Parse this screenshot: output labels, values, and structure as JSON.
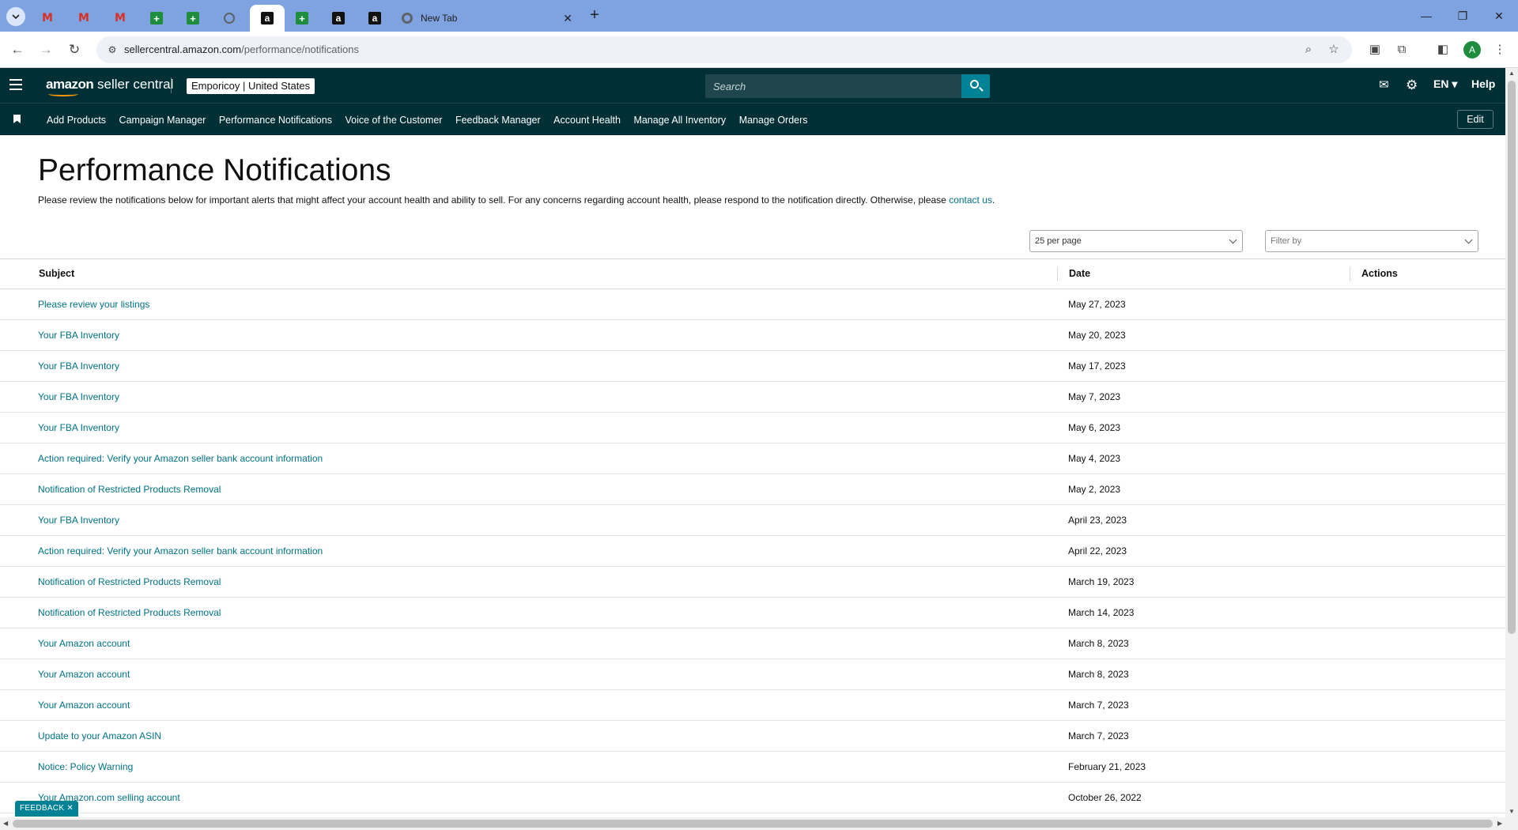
{
  "browser": {
    "tabs": [
      {
        "type": "gmail",
        "glyph": "M"
      },
      {
        "type": "gmail",
        "glyph": "M"
      },
      {
        "type": "gmail",
        "glyph": "M"
      },
      {
        "type": "sheets",
        "glyph": "+"
      },
      {
        "type": "sheets",
        "glyph": "+"
      },
      {
        "type": "globe",
        "glyph": ""
      },
      {
        "type": "amazon",
        "glyph": "a",
        "active": true
      },
      {
        "type": "sheets",
        "glyph": "+"
      },
      {
        "type": "amazon",
        "glyph": "a"
      },
      {
        "type": "amazon",
        "glyph": "a"
      }
    ],
    "new_tab_title": "New Tab",
    "url_domain": "sellercentral.amazon.com",
    "url_path": "/performance/notifications",
    "profile_initial": "A"
  },
  "header": {
    "logo_bold": "amazon",
    "logo_rest": " seller central",
    "store_name": "Emporicoy",
    "store_region": "United States",
    "search_placeholder": "Search",
    "lang": "EN",
    "help": "Help"
  },
  "nav": {
    "links": [
      "Add Products",
      "Campaign Manager",
      "Performance Notifications",
      "Voice of the Customer",
      "Feedback Manager",
      "Account Health",
      "Manage All Inventory",
      "Manage Orders"
    ],
    "edit": "Edit"
  },
  "page": {
    "title": "Performance Notifications",
    "intro": "Please review the notifications below for important alerts that might affect your account health and ability to sell. For any concerns regarding account health, please respond to the notification directly. Otherwise, please ",
    "intro_link": "contact us",
    "intro_end": ".",
    "per_page": "25 per page",
    "filter_placeholder": "Filter by"
  },
  "table": {
    "headers": {
      "subject": "Subject",
      "date": "Date",
      "actions": "Actions"
    },
    "rows": [
      {
        "subject": "Please review your listings",
        "date": "May 27, 2023"
      },
      {
        "subject": "Your FBA Inventory",
        "date": "May 20, 2023"
      },
      {
        "subject": "Your FBA Inventory",
        "date": "May 17, 2023"
      },
      {
        "subject": "Your FBA Inventory",
        "date": "May 7, 2023"
      },
      {
        "subject": "Your FBA Inventory",
        "date": "May 6, 2023"
      },
      {
        "subject": "Action required: Verify your Amazon seller bank account information",
        "date": "May 4, 2023"
      },
      {
        "subject": "Notification of Restricted Products Removal",
        "date": "May 2, 2023"
      },
      {
        "subject": "Your FBA Inventory",
        "date": "April 23, 2023"
      },
      {
        "subject": "Action required: Verify your Amazon seller bank account information",
        "date": "April 22, 2023"
      },
      {
        "subject": "Notification of Restricted Products Removal",
        "date": "March 19, 2023"
      },
      {
        "subject": "Notification of Restricted Products Removal",
        "date": "March 14, 2023"
      },
      {
        "subject": "Your Amazon account",
        "date": "March 8, 2023"
      },
      {
        "subject": "Your Amazon account",
        "date": "March 8, 2023"
      },
      {
        "subject": "Your Amazon account",
        "date": "March 7, 2023"
      },
      {
        "subject": "Update to your Amazon ASIN",
        "date": "March 7, 2023"
      },
      {
        "subject": "Notice: Policy Warning",
        "date": "February 21, 2023"
      },
      {
        "subject": "Your Amazon.com selling account",
        "date": "October 26, 2022"
      }
    ]
  },
  "feedback": "FEEDBACK",
  "colors": {
    "header_bg": "#002f36",
    "link": "#007185",
    "search_btn": "#008296",
    "tabstrip": "#7fa2e0"
  }
}
